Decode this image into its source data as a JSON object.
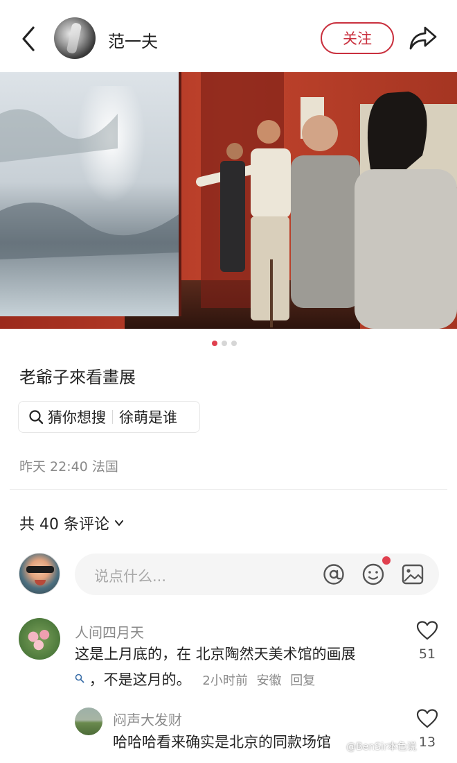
{
  "header": {
    "author_name": "范一夫",
    "follow_label": "关注"
  },
  "carousel": {
    "total": 3,
    "active_index": 0
  },
  "post": {
    "title": "老爺子來看畫展",
    "search_prefix": "猜你想搜",
    "search_suggestion": "徐萌是谁",
    "time": "昨天 22:40",
    "location": "法国"
  },
  "comments_section": {
    "count_label": "共 40 条评论",
    "input_placeholder": "说点什么..."
  },
  "comments": [
    {
      "user": "人间四月天",
      "text_line1": "这是上月底的，在 北京陶然天美术馆的画展",
      "text_line2": "，不是这月的。",
      "time": "2小时前",
      "region": "安徽",
      "reply_label": "回复",
      "likes": "51"
    },
    {
      "user": "闷声大发财",
      "text_line1": "哈哈哈看来确实是北京的同款场馆",
      "likes": "13"
    }
  ],
  "watermark": "@BenSir本色说",
  "colors": {
    "accent": "#c9303e",
    "dot_active": "#e0404f",
    "gallery_wall": "#b83a26"
  },
  "icons": [
    "back-icon",
    "share-icon",
    "search-icon",
    "chevron-down-icon",
    "at-icon",
    "emoji-icon",
    "image-icon",
    "heart-icon"
  ]
}
